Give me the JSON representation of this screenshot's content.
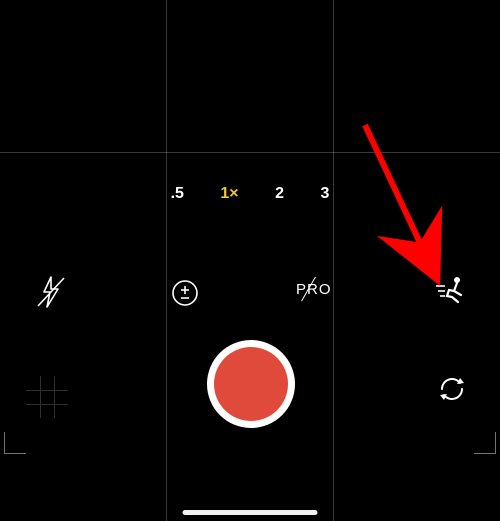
{
  "zoom": {
    "options": [
      {
        "label": ".5",
        "active": false
      },
      {
        "label": "1×",
        "active": true
      },
      {
        "label": "2",
        "active": false
      },
      {
        "label": "3",
        "active": false
      }
    ]
  },
  "controls": {
    "flash": {
      "name": "flash-off-icon"
    },
    "exposure": {
      "name": "exposure-icon"
    },
    "pro": {
      "label": "PRO",
      "name": "pro-mode-toggle"
    },
    "motion": {
      "name": "motion-tracking-icon"
    },
    "switch_camera": {
      "name": "switch-camera-icon"
    }
  },
  "shutter": {
    "color": "#e04a3b"
  },
  "annotation": {
    "arrow_color": "#ff0000"
  }
}
